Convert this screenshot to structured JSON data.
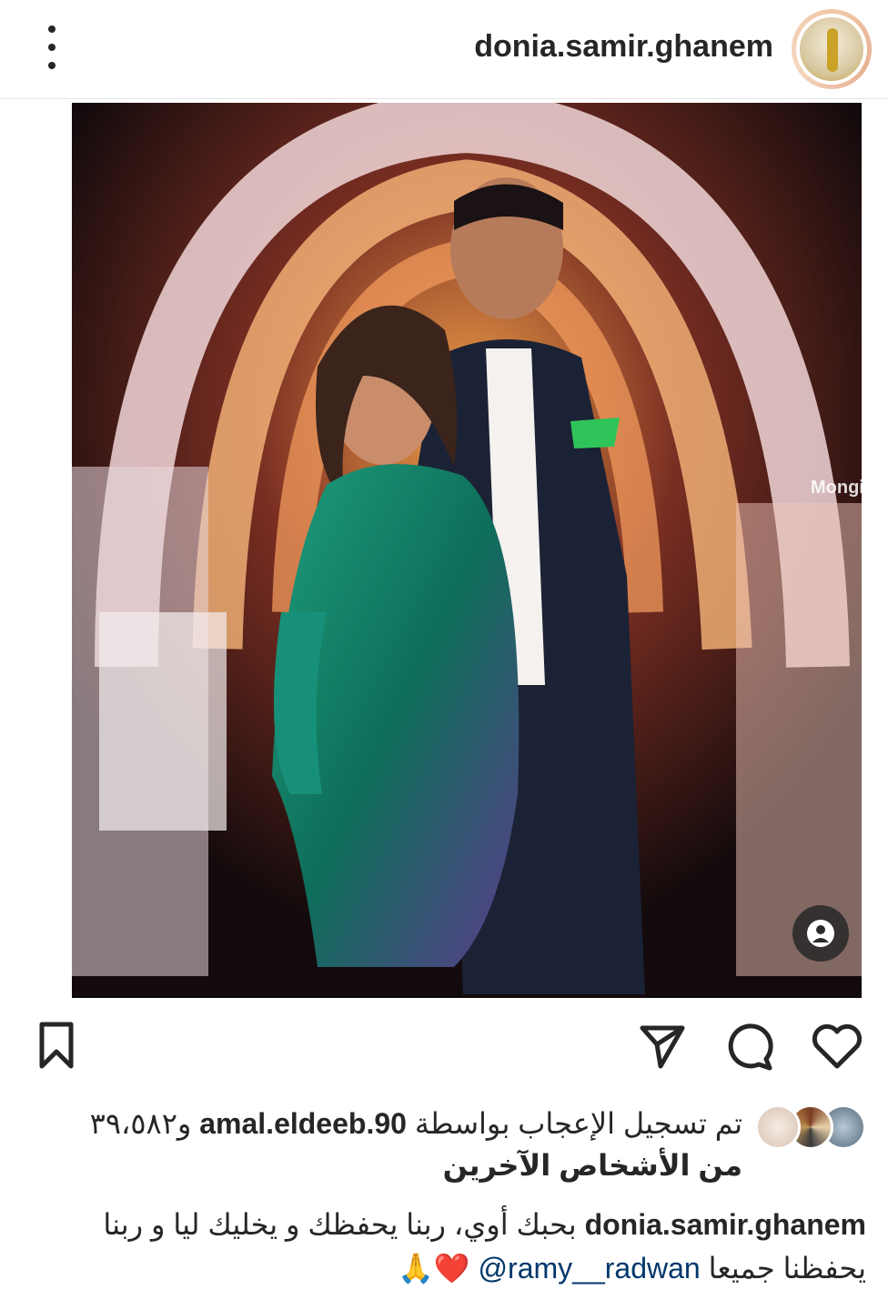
{
  "header": {
    "username": "donia.samir.ghanem",
    "avatar_icon": "profile-avatar",
    "more_icon": "vertical-dots-icon"
  },
  "post": {
    "photo_description_icon": "post-photo",
    "watermark": "Mongi",
    "tag_icon": "user-tag-icon"
  },
  "actions": {
    "save_icon": "bookmark-icon",
    "share_icon": "send-icon",
    "comment_icon": "comment-icon",
    "like_icon": "heart-icon"
  },
  "likes": {
    "prefix": "تم تسجيل الإعجاب بواسطة",
    "user": "amal.eldeeb.90",
    "count_text": "و٣٩،٥٨٢",
    "suffix": "من الأشخاص الآخرين"
  },
  "caption": {
    "user": "donia.samir.ghanem",
    "text": "بحبك أوي، ربنا يحفظك و يخليك ليا و ربنا يحفظنا جميعا",
    "mention": "@ramy__radwan",
    "emojis": "❤️🙏"
  },
  "colors": {
    "text": "#262626",
    "mention": "#00376b",
    "divider": "#e6e6e6"
  }
}
